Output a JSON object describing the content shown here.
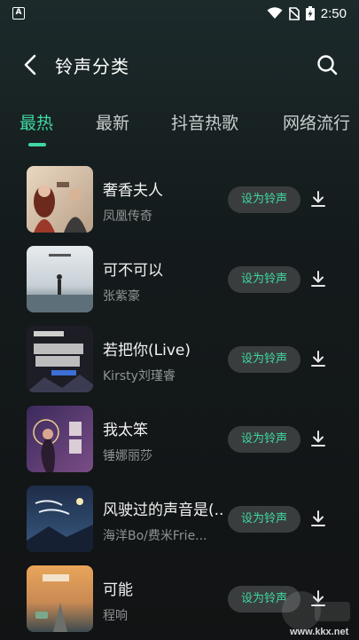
{
  "status_bar": {
    "app_badge": "A",
    "time": "2:50",
    "icons": [
      "wifi-icon",
      "no-sim-icon",
      "battery-charging-icon"
    ]
  },
  "header": {
    "title": "铃声分类",
    "back_icon": "chevron-left-icon",
    "search_icon": "search-icon"
  },
  "tabs": [
    {
      "label": "最热",
      "active": true
    },
    {
      "label": "最新",
      "active": false
    },
    {
      "label": "抖音热歌",
      "active": false
    },
    {
      "label": "网络流行",
      "active": false
    }
  ],
  "songs": [
    {
      "title": "奢香夫人",
      "artist": "凤凰传奇",
      "button": "设为铃声"
    },
    {
      "title": "可不可以",
      "artist": "张紫豪",
      "button": "设为铃声"
    },
    {
      "title": "若把你(Live)",
      "artist": "Kirsty刘瑾睿",
      "button": "设为铃声"
    },
    {
      "title": "我太笨",
      "artist": "锤娜丽莎",
      "button": "设为铃声"
    },
    {
      "title": "风驶过的声音是(..",
      "artist": "海洋Bo/费米Frie...",
      "button": "设为铃声"
    },
    {
      "title": "可能",
      "artist": "程响",
      "button": "设为铃声"
    }
  ],
  "colors": {
    "accent": "#3ed8a0",
    "background": "#141b1c",
    "button_bg": "#3a3d3e"
  },
  "watermark": {
    "text": "www.kkx.net"
  }
}
